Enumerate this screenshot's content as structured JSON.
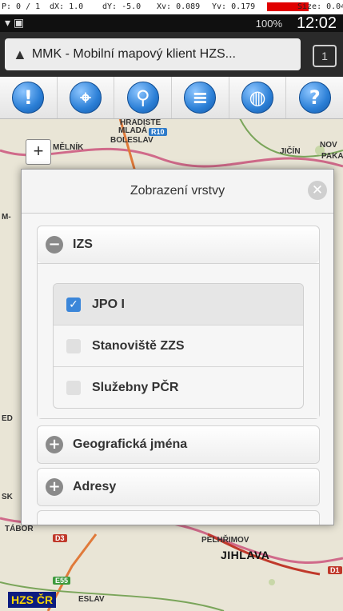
{
  "debug": {
    "p": "P: 0 / 1",
    "dx": "dX: 1.0",
    "dy": "dY: -5.0",
    "xv": "Xv: 0.089",
    "yv": "Yv: 0.179",
    "prs": "Prs: 1.0",
    "size": "Size: 0.04"
  },
  "status_bar": {
    "battery": "100%",
    "time": "12:02"
  },
  "browser": {
    "title": "MMK - Mobilní mapový klient HZS...",
    "tabs_count": "1"
  },
  "toolbar": {
    "buttons": [
      {
        "icon": "alert-icon",
        "glyph": "!"
      },
      {
        "icon": "locate-icon",
        "glyph": "⌖"
      },
      {
        "icon": "search-icon",
        "glyph": "⚲"
      },
      {
        "icon": "layers-icon",
        "glyph": "≡"
      },
      {
        "icon": "globe-icon",
        "glyph": "◍"
      },
      {
        "icon": "help-icon",
        "glyph": "?"
      }
    ],
    "accent": "#2b7fd6"
  },
  "map": {
    "labels": {
      "mlada": "MLADÁ",
      "boleslav": "BOLESLAV",
      "r10": "R10",
      "melnik": "MĚLNÍK",
      "jicin": "JIČÍN",
      "nov": "NOV",
      "paka": "PAKA",
      "hradiste": "HRADIŠTĚ",
      "pelhrimov": "PELHŘIMOV",
      "jihlava": "JIHLAVA",
      "tabor": "TÁBOR",
      "d3": "D3",
      "d1": "D1",
      "e55": "E55",
      "eslav": "ESLAV",
      "m": "M-",
      "sk": "SK",
      "ed": "ED"
    },
    "zoom_in": "+",
    "logo": "HZS ČR"
  },
  "modal": {
    "title": "Zobrazení vrstvy",
    "close": "✕",
    "sections": [
      {
        "label": "IZS",
        "expanded": true,
        "items": [
          {
            "label": "JPO I",
            "checked": true
          },
          {
            "label": "Stanoviště ZZS",
            "checked": false
          },
          {
            "label": "Služebny PČR",
            "checked": false
          }
        ]
      },
      {
        "label": "Geografická jména",
        "expanded": false
      },
      {
        "label": "Adresy",
        "expanded": false
      }
    ],
    "checkbox_color": "#3b86d9"
  }
}
